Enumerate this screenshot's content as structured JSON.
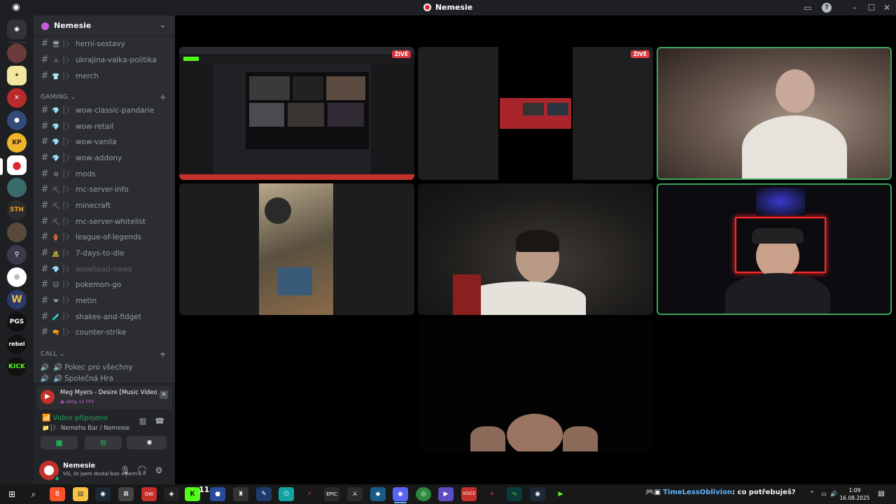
{
  "window": {
    "title": "Nemesie"
  },
  "server": {
    "name": "Nemesie"
  },
  "channels_top": [
    {
      "emoji": "🖥",
      "name": "herní-sestavy"
    },
    {
      "emoji": "⚔",
      "name": "ukrajina-valka-politika"
    },
    {
      "emoji": "👕",
      "name": "merch"
    }
  ],
  "categories": {
    "gaming": "GAMING",
    "call": "CALL"
  },
  "gaming_channels": [
    {
      "emoji": "💎",
      "name": "wow-classic-pandarie"
    },
    {
      "emoji": "💎",
      "name": "wow-retail"
    },
    {
      "emoji": "💎",
      "name": "wow-vanila"
    },
    {
      "emoji": "💎",
      "name": "wow-addony"
    },
    {
      "emoji": "⚙",
      "name": "mods"
    },
    {
      "emoji": "⛏",
      "name": "mc-server-info"
    },
    {
      "emoji": "⛏",
      "name": "minecraft"
    },
    {
      "emoji": "⛏",
      "name": "mc-server-whitelist"
    },
    {
      "emoji": "🏺",
      "name": "league-of-legends"
    },
    {
      "emoji": "🧟",
      "name": "7-days-to-die"
    },
    {
      "emoji": "💎",
      "name": "wowhead-news"
    },
    {
      "emoji": "🐱",
      "name": "pokemon-go"
    },
    {
      "emoji": "❤",
      "name": "metin"
    },
    {
      "emoji": "🧪",
      "name": "shakes-and-fidget"
    },
    {
      "emoji": "🔫",
      "name": "counter-strike"
    }
  ],
  "call_channels": [
    {
      "name": "Pokec pro všechny"
    },
    {
      "name": "Společná Hra"
    }
  ],
  "activity": {
    "title": "Meg Myers - Desire [Music Video] - YouTu...",
    "quality": "480p 15 FPS",
    "video_status": "Video připojeno",
    "voice_channel": "Nemeho Bar / Nemesie"
  },
  "user": {
    "name": "Nemesie",
    "status": "Víš, že jsem dostal ban a jsem..."
  },
  "live_badge": "ŽIVĚ",
  "taskbar": {
    "badge": "11",
    "notif_user": "TimeLessOblivion",
    "notif_msg": ": co potřebuješ?",
    "time": "1:09",
    "date": "16.08.2025"
  },
  "colors": {
    "speaking": "#3ba55c",
    "live": "#da373c",
    "online": "#23a55a",
    "accent": "#5865f2"
  }
}
